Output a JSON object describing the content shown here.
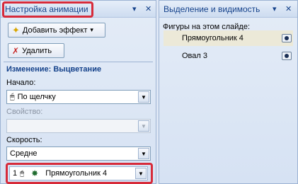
{
  "animation_pane": {
    "title": "Настройка анимации",
    "dropdown_glyph": "▾",
    "close_glyph": "✕",
    "add_effect_button": "Добавить эффект",
    "add_effect_arrow": "▾",
    "delete_button": "Удалить",
    "change_heading": "Изменение: Выцветание",
    "start_label": "Начало:",
    "start_value": "По щелчку",
    "property_label": "Свойство:",
    "property_value": "",
    "speed_label": "Скорость:",
    "speed_value": "Средне",
    "combo_arrow": "▼",
    "effect_item": {
      "order": "1",
      "name": "Прямоугольник 4"
    }
  },
  "selection_pane": {
    "title": "Выделение и видимость",
    "dropdown_glyph": "▾",
    "close_glyph": "✕",
    "shapes_label": "Фигуры на этом слайде:",
    "shapes": [
      {
        "name": "Прямоугольник 4",
        "selected": true
      },
      {
        "name": "Овал 3",
        "selected": false
      }
    ]
  },
  "highlight_color": "#d72b3a",
  "icons": [
    "star-icon",
    "delete-icon",
    "mouse-click-icon",
    "effect-star-icon",
    "eye-icon",
    "dropdown-arrow-icon",
    "close-icon"
  ]
}
